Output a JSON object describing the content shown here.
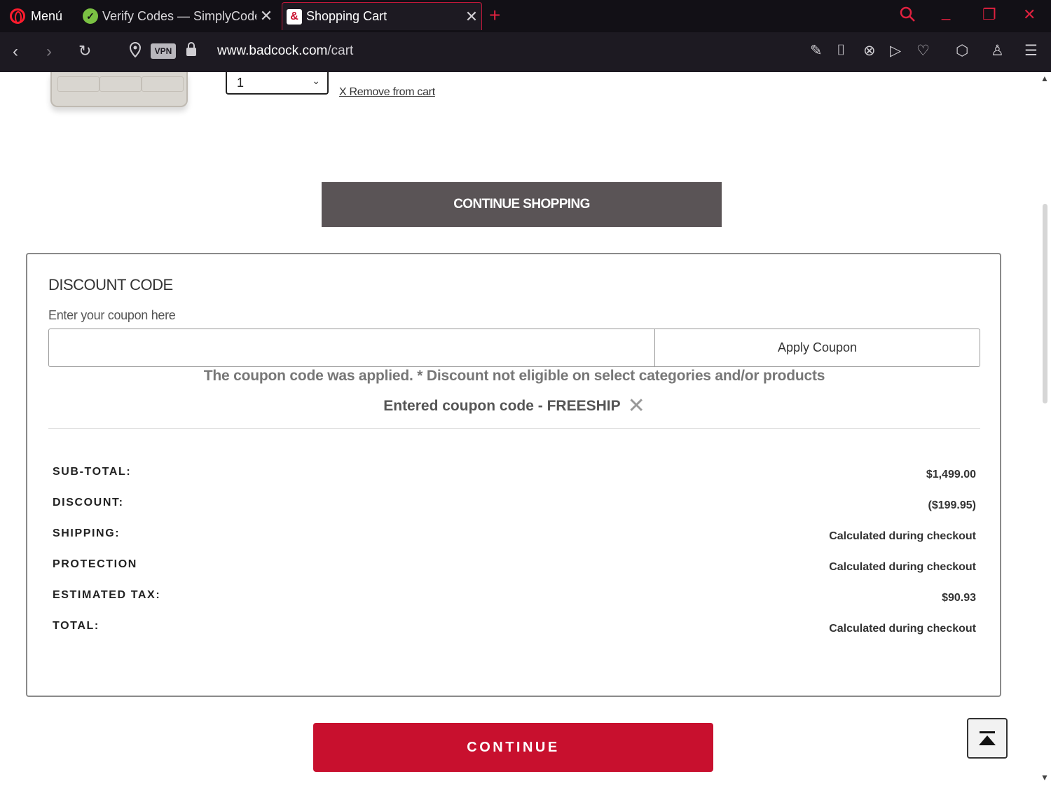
{
  "browser": {
    "menu_label": "Menú",
    "tabs": [
      {
        "title": "Verify Codes — SimplyCodes",
        "favicon": "simplycodes-check-icon"
      },
      {
        "title": "Shopping Cart",
        "favicon": "badcock-logo-icon"
      }
    ],
    "url_domain": "www.badcock.com",
    "url_path": "/cart",
    "vpn_label": "VPN"
  },
  "cart_item": {
    "quantity": "1",
    "remove_label": "X Remove from cart"
  },
  "continue_shopping_label": "CONTINUE SHOPPING",
  "discount": {
    "title": "DISCOUNT CODE",
    "input_label": "Enter your coupon here",
    "input_value": "",
    "apply_label": "Apply Coupon",
    "applied_message": "The coupon code was applied. * Discount not eligible on select categories and/or products",
    "entered_code_text": "Entered coupon code - FREESHIP"
  },
  "summary": [
    {
      "label": "SUB-TOTAL:",
      "value": "$1,499.00"
    },
    {
      "label": "DISCOUNT:",
      "value": "($199.95)"
    },
    {
      "label": "SHIPPING:",
      "value": "Calculated during checkout"
    },
    {
      "label": "PROTECTION",
      "value": "Calculated during checkout"
    },
    {
      "label": "ESTIMATED TAX:",
      "value": "$90.93"
    },
    {
      "label": "TOTAL:",
      "value": "Calculated during checkout"
    }
  ],
  "continue_label": "CONTINUE",
  "colors": {
    "brand_red": "#c8102e",
    "continue_shopping_bg": "#5a5456",
    "browser_dark": "#121016"
  }
}
